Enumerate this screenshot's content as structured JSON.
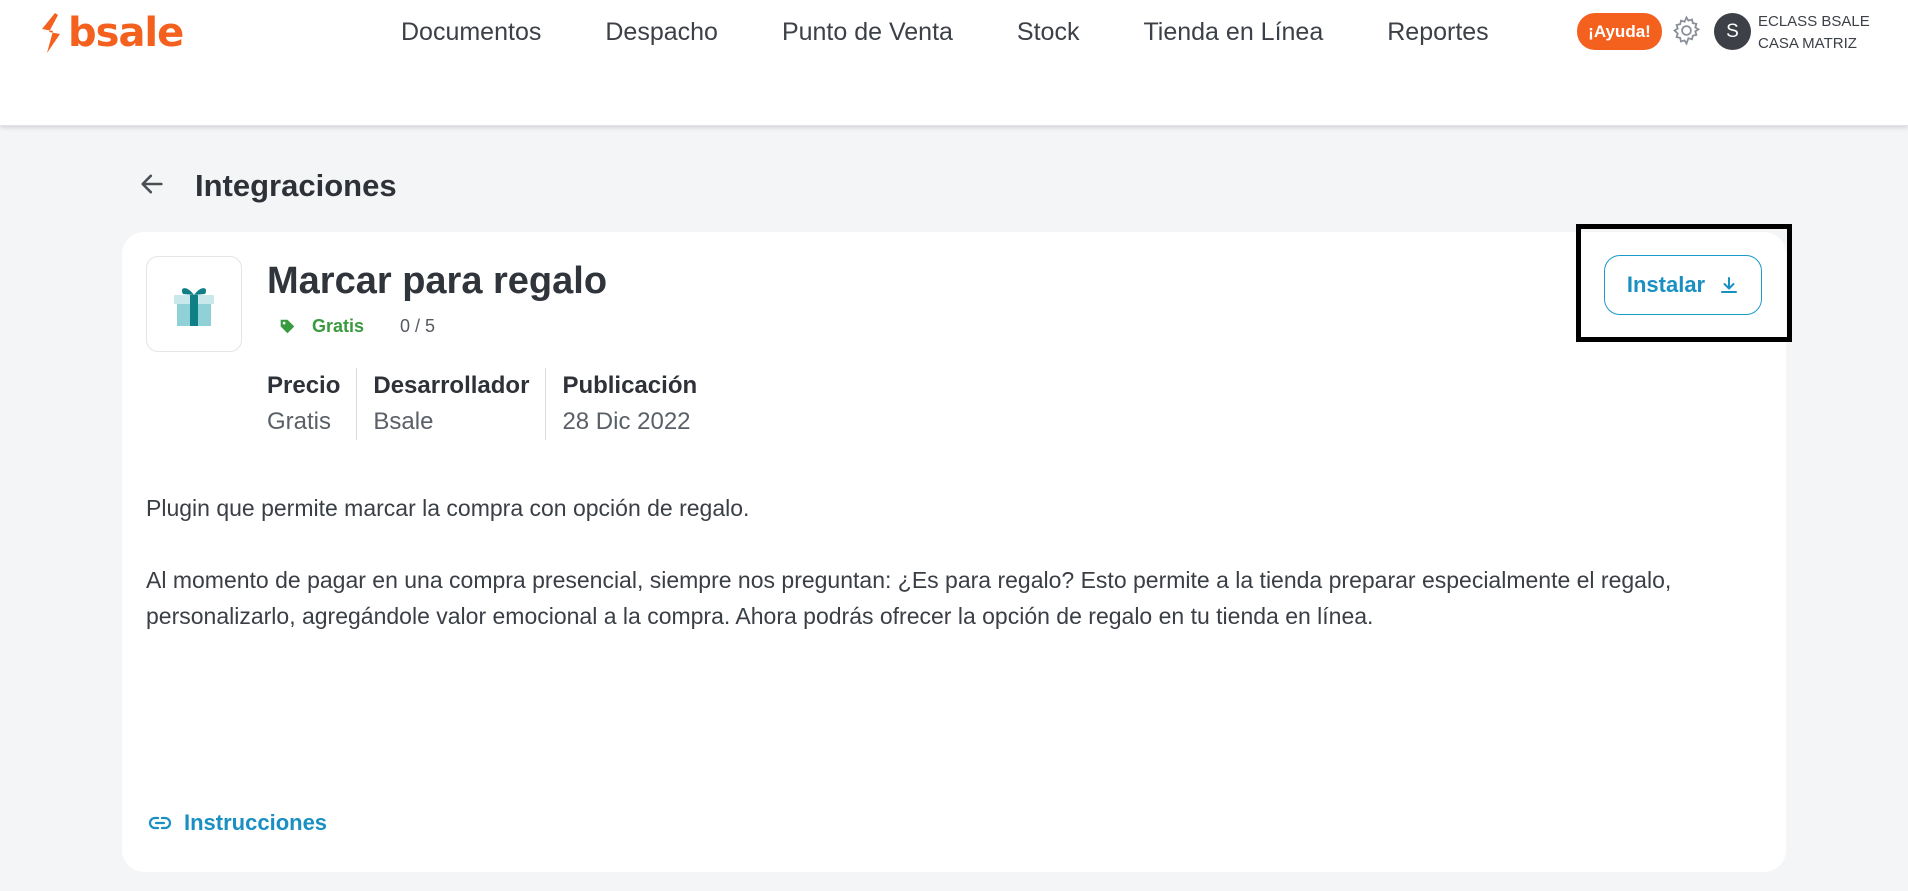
{
  "header": {
    "logo_text": "bsale",
    "nav": [
      "Documentos",
      "Despacho",
      "Punto de Venta",
      "Stock",
      "Tienda en Línea",
      "Reportes"
    ],
    "help_label": "¡Ayuda!",
    "avatar_initial": "S",
    "account_line1": "ECLASS BSALE",
    "account_line2": "CASA MATRIZ",
    "brand_color": "#f4601e"
  },
  "breadcrumb": {
    "title": "Integraciones"
  },
  "app": {
    "title": "Marcar para regalo",
    "price_tag": "Gratis",
    "rating": "0 / 5",
    "details": [
      {
        "label": "Precio",
        "value": "Gratis"
      },
      {
        "label": "Desarrollador",
        "value": "Bsale"
      },
      {
        "label": "Publicación",
        "value": "28 Dic 2022"
      }
    ],
    "description": [
      "Plugin que permite marcar la compra con opción de regalo.",
      "Al momento de pagar en una compra presencial, siempre nos preguntan: ¿Es para regalo? Esto permite a la tienda preparar especialmente el regalo, personalizarlo, agregándole valor emocional a la compra. Ahora podrás ofrecer la opción de regalo en tu tienda en línea."
    ],
    "install_label": "Instalar",
    "instructions_label": "Instrucciones",
    "icon": "gift-icon",
    "accent_color": "#1a8fc2",
    "price_color": "#3a9a3f"
  }
}
